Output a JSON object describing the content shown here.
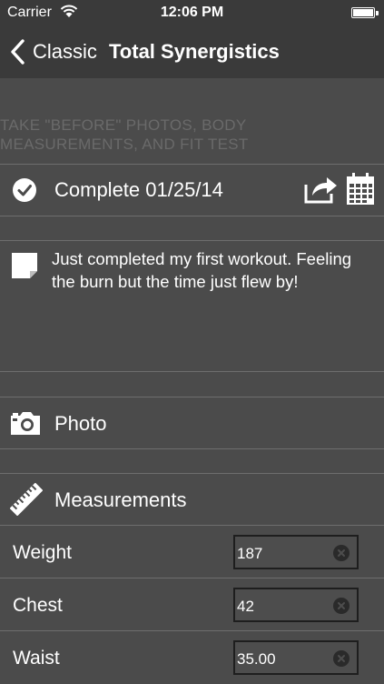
{
  "status_bar": {
    "carrier": "Carrier",
    "time": "12:06 PM"
  },
  "nav": {
    "back_label": "Classic",
    "title": "Total Synergistics"
  },
  "task": {
    "line1": "TAKE \"BEFORE\" PHOTOS, BODY",
    "line2": "MEASUREMENTS, AND FIT TEST"
  },
  "complete": {
    "label": "Complete 01/25/14"
  },
  "note": {
    "text": "Just completed my first workout. Feeling the burn but the time just flew by!"
  },
  "photo": {
    "label": "Photo"
  },
  "measurements": {
    "label": "Measurements",
    "rows": [
      {
        "label": "Weight",
        "value": "187"
      },
      {
        "label": "Chest",
        "value": "42"
      },
      {
        "label": "Waist",
        "value": "35.00"
      }
    ]
  },
  "icons": {
    "wifi": "wifi-icon",
    "battery": "battery-icon",
    "back": "chevron-left-icon",
    "check": "checkmark-circle-icon",
    "share": "share-icon",
    "calendar": "calendar-icon",
    "note": "note-icon",
    "camera": "camera-icon",
    "ruler": "ruler-icon",
    "clear": "clear-icon"
  },
  "colors": {
    "background": "#4b4b4b",
    "bar": "#3a3a3a",
    "divider": "#6e6e6e",
    "task_text": "#6a6a6a"
  }
}
